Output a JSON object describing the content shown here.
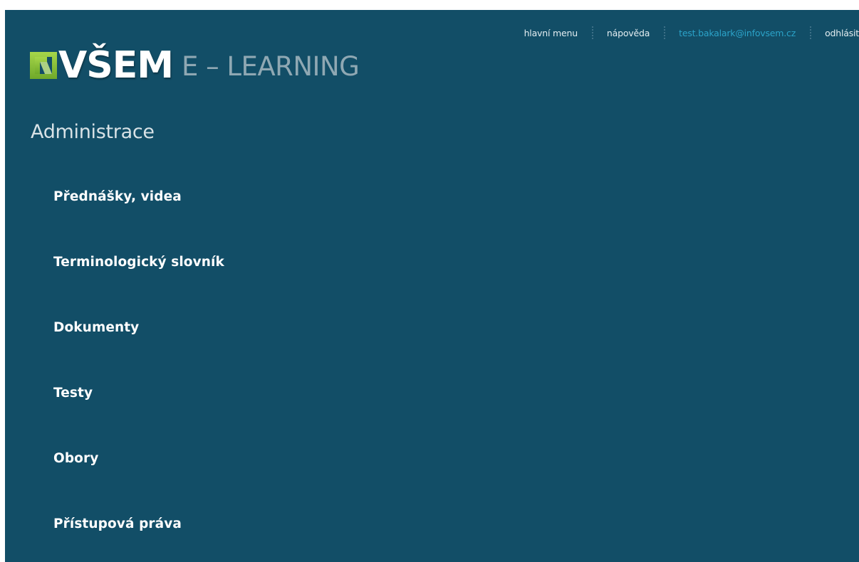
{
  "top_nav": {
    "main_menu": "hlavní menu",
    "help": "nápověda",
    "user_email": "test.bakalark@infovsem.cz",
    "logout": "odhlásit"
  },
  "logo": {
    "brand": "VŠEM",
    "subtitle": "E – LEARNING"
  },
  "page": {
    "title": "Administrace"
  },
  "admin_menu": {
    "items": [
      {
        "label": "Přednášky, videa"
      },
      {
        "label": "Terminologický slovník"
      },
      {
        "label": "Dokumenty"
      },
      {
        "label": "Testy"
      },
      {
        "label": "Obory"
      },
      {
        "label": "Přístupová práva"
      }
    ]
  },
  "colors": {
    "background": "#124e67",
    "logo_green": "#8dc63f",
    "user_link": "#2ba3c9",
    "subtitle_gray": "#8fa8b3"
  }
}
